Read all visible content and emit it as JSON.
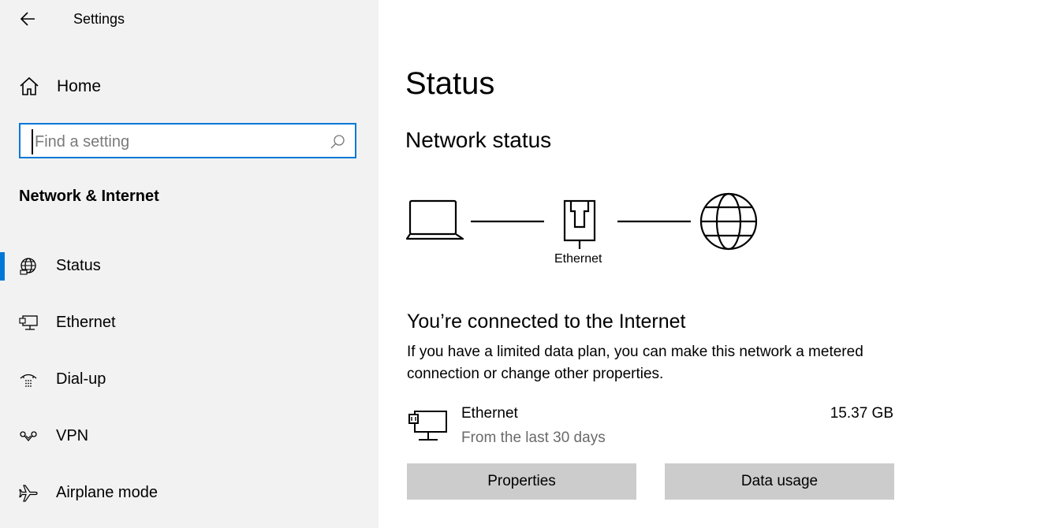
{
  "app": {
    "title": "Settings"
  },
  "sidebar": {
    "home_label": "Home",
    "search": {
      "placeholder": "Find a setting",
      "value": ""
    },
    "section_title": "Network & Internet",
    "items": [
      {
        "label": "Status",
        "icon": "globe-status-icon",
        "active": true
      },
      {
        "label": "Ethernet",
        "icon": "ethernet-icon"
      },
      {
        "label": "Dial-up",
        "icon": "dialup-icon"
      },
      {
        "label": "VPN",
        "icon": "vpn-icon"
      },
      {
        "label": "Airplane mode",
        "icon": "airplane-icon"
      }
    ]
  },
  "main": {
    "title": "Status",
    "network_status_title": "Network status",
    "diagram": {
      "middle_label": "Ethernet"
    },
    "connection": {
      "title": "You’re connected to the Internet",
      "description": "If you have a limited data plan, you can make this network a metered connection or change other properties."
    },
    "adapter": {
      "name": "Ethernet",
      "period": "From the last 30 days",
      "usage": "15.37 GB"
    },
    "buttons": {
      "properties": "Properties",
      "data_usage": "Data usage"
    }
  },
  "colors": {
    "accent": "#0078d7",
    "sidebar_bg": "#f2f2f2",
    "button_bg": "#cccccc"
  }
}
